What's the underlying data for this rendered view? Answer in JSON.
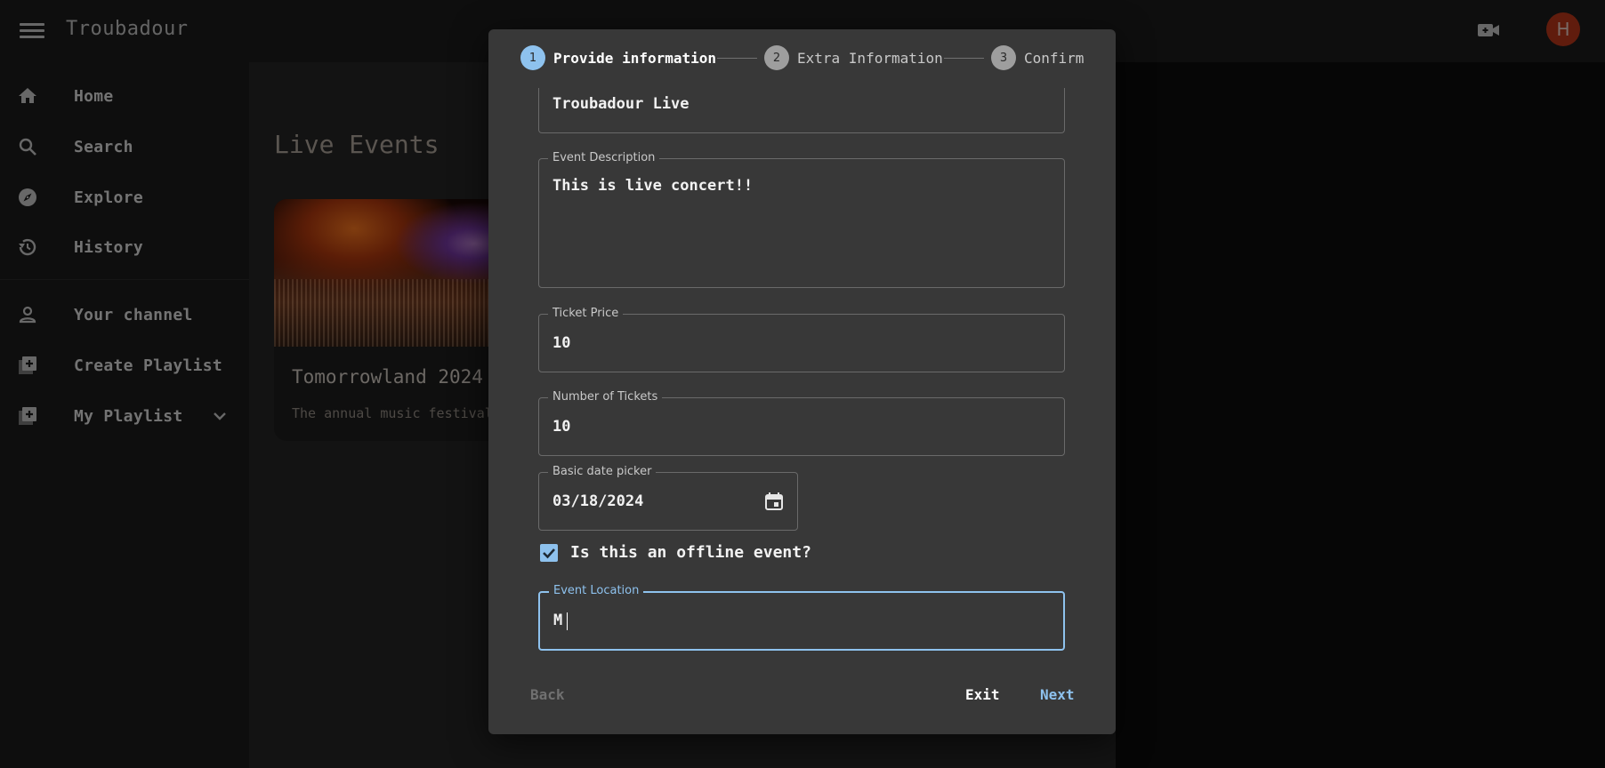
{
  "app": {
    "title": "Troubadour",
    "avatar_initial": "H"
  },
  "sidebar": {
    "items": [
      {
        "label": "Home",
        "icon": "home-icon"
      },
      {
        "label": "Search",
        "icon": "search-icon"
      },
      {
        "label": "Explore",
        "icon": "compass-icon"
      },
      {
        "label": "History",
        "icon": "history-icon"
      },
      {
        "label": "Your channel",
        "icon": "person-icon"
      },
      {
        "label": "Create Playlist",
        "icon": "playlist-add-icon"
      },
      {
        "label": "My Playlist",
        "icon": "playlist-add-icon"
      }
    ]
  },
  "main": {
    "section_title": "Live Events",
    "event_card": {
      "title": "Tomorrowland 2024",
      "description": "The annual music festival"
    }
  },
  "dialog": {
    "steps": [
      {
        "number": "1",
        "label": "Provide information",
        "state": "active"
      },
      {
        "number": "2",
        "label": "Extra Information",
        "state": "inactive"
      },
      {
        "number": "3",
        "label": "Confirm",
        "state": "inactive"
      }
    ],
    "event_name_value": "Troubadour Live",
    "description": {
      "label": "Event Description",
      "value": "This is live concert!!"
    },
    "ticket_price": {
      "label": "Ticket Price",
      "value": "10"
    },
    "num_tickets": {
      "label": "Number of Tickets",
      "value": "10"
    },
    "date_picker": {
      "label": "Basic date picker",
      "value": "03/18/2024"
    },
    "offline": {
      "label": "Is this an offline event?",
      "checked": true
    },
    "location": {
      "label": "Event Location",
      "value": "M"
    },
    "buttons": {
      "back": "Back",
      "exit": "Exit",
      "next": "Next"
    }
  },
  "colors": {
    "accent": "#8ec2ee",
    "avatar": "#c0391a"
  }
}
